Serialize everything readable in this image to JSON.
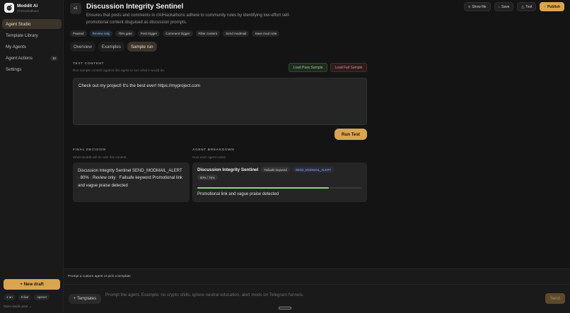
{
  "brand": {
    "name": "Moddit Ai",
    "sub": "r/AIHackathons"
  },
  "nav": [
    {
      "label": "Agent Studio",
      "active": true
    },
    {
      "label": "Template Library"
    },
    {
      "label": "My Agents"
    },
    {
      "label": "Agent Actions",
      "count": "10"
    },
    {
      "label": "Settings"
    }
  ],
  "sidebar": {
    "new_draft": "+ New draft",
    "pills": [
      "1 on",
      "0 live",
      "opener"
    ],
    "link": "Open studio post →"
  },
  "agent": {
    "icon_text": "s1",
    "title": "Discussion Integrity Sentinel",
    "description": "Ensures that posts and comments in r/AIHackathons adhere to community rules by identifying low-effort self-promotional content disguised as discussion prompts."
  },
  "actions": {
    "show_file": "Show file",
    "save": "Save",
    "test": "Test",
    "publish": "Publish"
  },
  "tags": [
    "Paused",
    "Review only",
    "75% gate",
    "Post trigger",
    "Comment trigger",
    "Filter content",
    "Send modmail",
    "Save mod note"
  ],
  "tabs": [
    {
      "label": "Overview"
    },
    {
      "label": "Examples"
    },
    {
      "label": "Sample run",
      "active": true
    }
  ],
  "test": {
    "label": "TEST CONTENT",
    "help": "Run sample content against this agent to see what it would do.",
    "load_pass": "Load Pass Sample",
    "load_fail": "Load Fail Sample",
    "content": "Check out my project! It's the best ever! https://myproject.com",
    "run": "Run Test"
  },
  "decision": {
    "label": "FINAL DECISION",
    "help": "What Moddit will do with this content.",
    "text": "Discussion Integrity Sentinel SEND_MODMAIL_ALERT · 80% · Review only · Failsafe keyword Promotional link and vague praise detected"
  },
  "breakdown": {
    "label": "AGENT BREAKDOWN",
    "help": "How each agent voted.",
    "name": "Discussion Integrity Sentinel",
    "chip1": "Failsafe keyword",
    "chip2": "SEND_MODMAIL_ALERT",
    "score": "80% / 75%",
    "progress": 0.8,
    "reason": "Promotional link and vague praise detected"
  },
  "prompt": {
    "label": "Prompt a custom agent or pick a template",
    "templates": "+ Templates",
    "placeholder": "Prompt the agent. Example: no crypto shills, ignore neutral education, alert mods on Telegram funnels.",
    "send": "Send"
  },
  "colors": {
    "accent": "#d9a54e",
    "success": "#8fcf8f",
    "danger": "#d98c8c"
  }
}
